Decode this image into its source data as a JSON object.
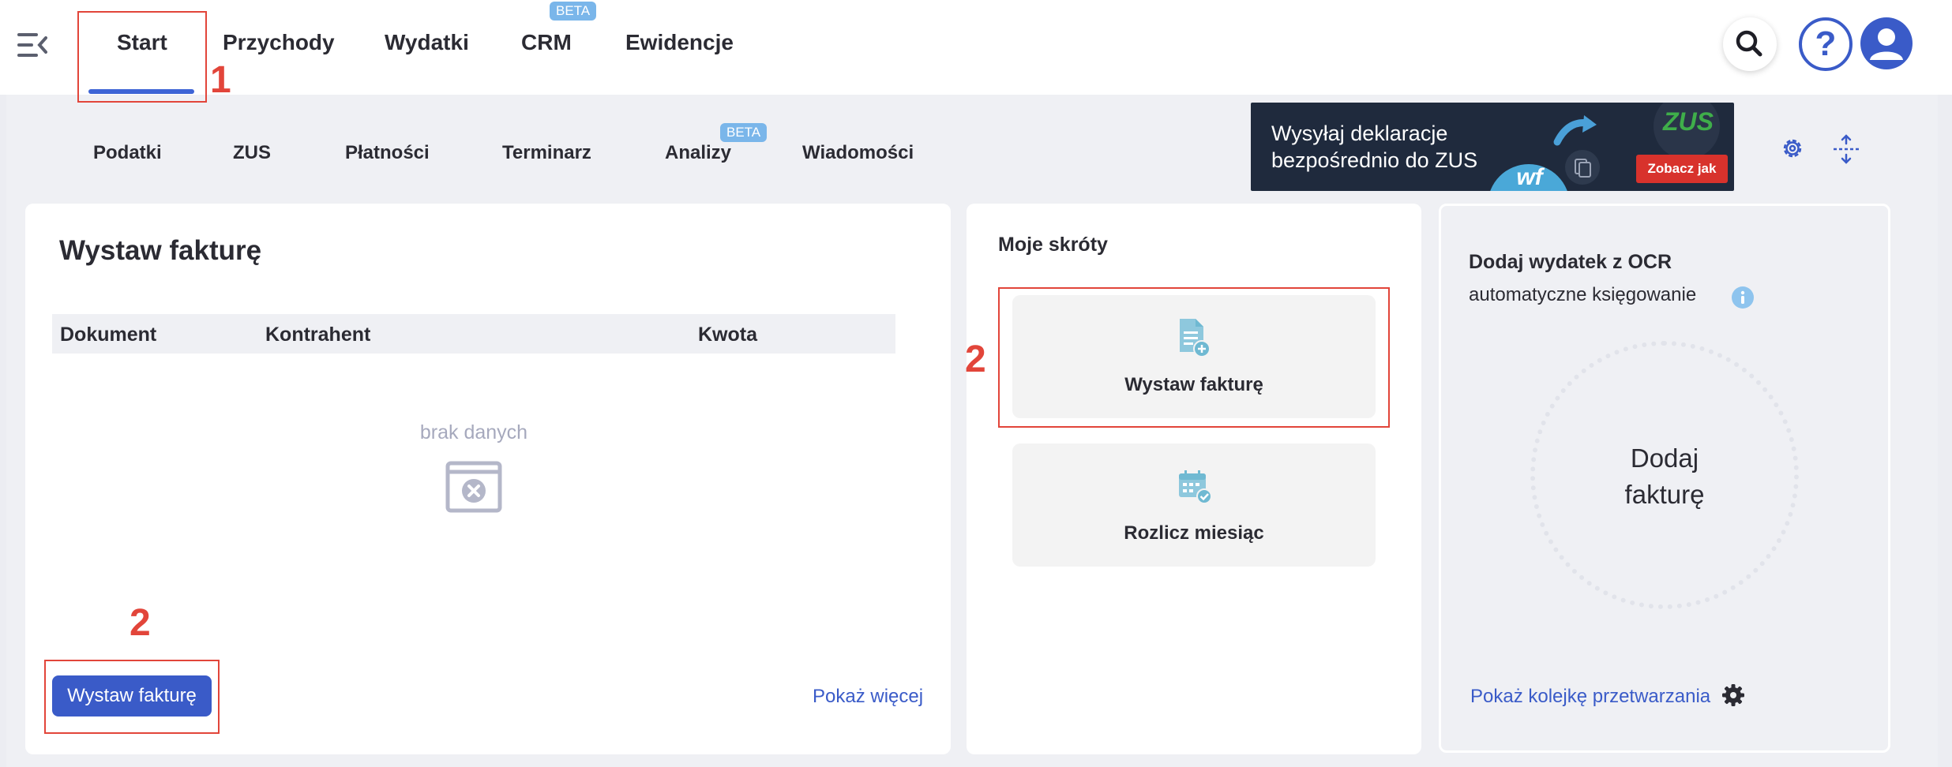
{
  "nav": {
    "tabs": [
      {
        "label": "Start"
      },
      {
        "label": "Przychody"
      },
      {
        "label": "Wydatki"
      },
      {
        "label": "CRM",
        "badge": "BETA"
      },
      {
        "label": "Ewidencje"
      }
    ]
  },
  "subnav": {
    "tabs": [
      {
        "label": "Podatki"
      },
      {
        "label": "ZUS"
      },
      {
        "label": "Płatności"
      },
      {
        "label": "Terminarz"
      },
      {
        "label": "Analizy",
        "badge": "BETA"
      },
      {
        "label": "Wiadomości"
      }
    ]
  },
  "banner": {
    "text": "Wysyłaj deklaracje bezpośrednio do ZUS",
    "logo": "ZUS",
    "brand": "wf",
    "cta": "Zobacz jak"
  },
  "invoice_card": {
    "title": "Wystaw fakturę",
    "columns": [
      "Dokument",
      "Kontrahent",
      "Kwota"
    ],
    "empty": "brak danych",
    "button": "Wystaw fakturę",
    "more": "Pokaż więcej"
  },
  "shortcuts": {
    "title": "Moje skróty",
    "items": [
      {
        "label": "Wystaw fakturę",
        "icon": "document-add-icon"
      },
      {
        "label": "Rozlicz miesiąc",
        "icon": "calendar-check-icon"
      }
    ]
  },
  "ocr": {
    "title": "Dodaj wydatek z OCR",
    "subtitle": "automatyczne księgowanie",
    "drop": "Dodaj fakturę",
    "queue": "Pokaż kolejkę przetwarzania"
  },
  "annotations": [
    "1",
    "2",
    "2"
  ],
  "colors": {
    "accent": "#3a5bc8",
    "annotation": "#e2453a",
    "beta": "#7ab6ea",
    "icon_teal": "#6fb9d2"
  }
}
